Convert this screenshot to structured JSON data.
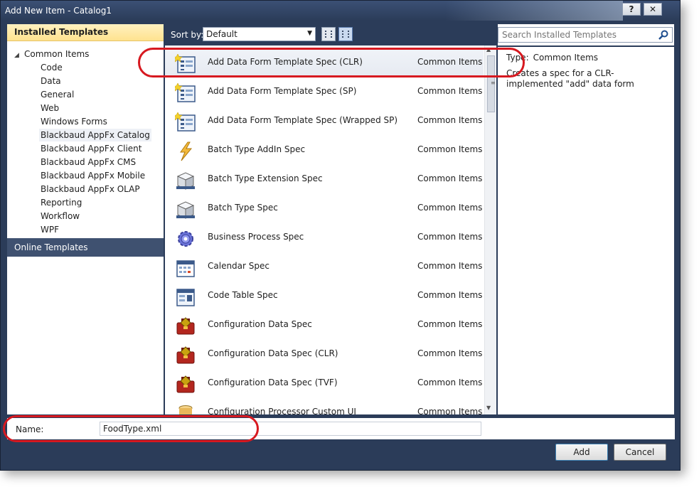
{
  "window": {
    "title": "Add New Item - Catalog1",
    "help_label": "?",
    "close_label": "✕"
  },
  "left": {
    "installed_header": "Installed Templates",
    "root_label": "Common Items",
    "items": [
      {
        "label": "Code"
      },
      {
        "label": "Data"
      },
      {
        "label": "General"
      },
      {
        "label": "Web"
      },
      {
        "label": "Windows Forms"
      },
      {
        "label": "Blackbaud AppFx Catalog",
        "selected": true
      },
      {
        "label": "Blackbaud AppFx Client"
      },
      {
        "label": "Blackbaud AppFx CMS"
      },
      {
        "label": "Blackbaud AppFx Mobile"
      },
      {
        "label": "Blackbaud AppFx OLAP"
      },
      {
        "label": "Reporting"
      },
      {
        "label": "Workflow"
      },
      {
        "label": "WPF"
      }
    ],
    "online_header": "Online Templates"
  },
  "sortbar": {
    "label": "Sort by:",
    "selected": "Default"
  },
  "templates": [
    {
      "name": "Add Data Form Template Spec (CLR)",
      "category": "Common Items",
      "icon": "data-form-icon",
      "selected": true
    },
    {
      "name": "Add Data Form Template Spec (SP)",
      "category": "Common Items",
      "icon": "data-form-icon"
    },
    {
      "name": "Add Data Form Template Spec (Wrapped SP)",
      "category": "Common Items",
      "icon": "data-form-icon"
    },
    {
      "name": "Batch Type AddIn Spec",
      "category": "Common Items",
      "icon": "lightning-icon"
    },
    {
      "name": "Batch Type Extension Spec",
      "category": "Common Items",
      "icon": "batch-box-icon"
    },
    {
      "name": "Batch Type Spec",
      "category": "Common Items",
      "icon": "batch-box-icon"
    },
    {
      "name": "Business Process Spec",
      "category": "Common Items",
      "icon": "gear-icon"
    },
    {
      "name": "Calendar Spec",
      "category": "Common Items",
      "icon": "calendar-icon"
    },
    {
      "name": "Code Table Spec",
      "category": "Common Items",
      "icon": "code-table-icon"
    },
    {
      "name": "Configuration Data Spec",
      "category": "Common Items",
      "icon": "toolbox-icon"
    },
    {
      "name": "Configuration Data Spec (CLR)",
      "category": "Common Items",
      "icon": "toolbox-icon"
    },
    {
      "name": "Configuration Data Spec (TVF)",
      "category": "Common Items",
      "icon": "toolbox-icon"
    },
    {
      "name": "Configuration Processor Custom UI",
      "category": "Common Items",
      "icon": "cylinder-icon"
    }
  ],
  "details": {
    "search_placeholder": "Search Installed Templates",
    "type_label": "Type:",
    "type_value": "Common Items",
    "description": "Creates a spec for a CLR-implemented \"add\" data form"
  },
  "name_field": {
    "label": "Name:",
    "value": "FoodType.xml"
  },
  "buttons": {
    "add": "Add",
    "cancel": "Cancel"
  },
  "colors": {
    "chrome": "#2b3c59",
    "selected_header": "#ffe28f",
    "callout": "#d71920"
  }
}
